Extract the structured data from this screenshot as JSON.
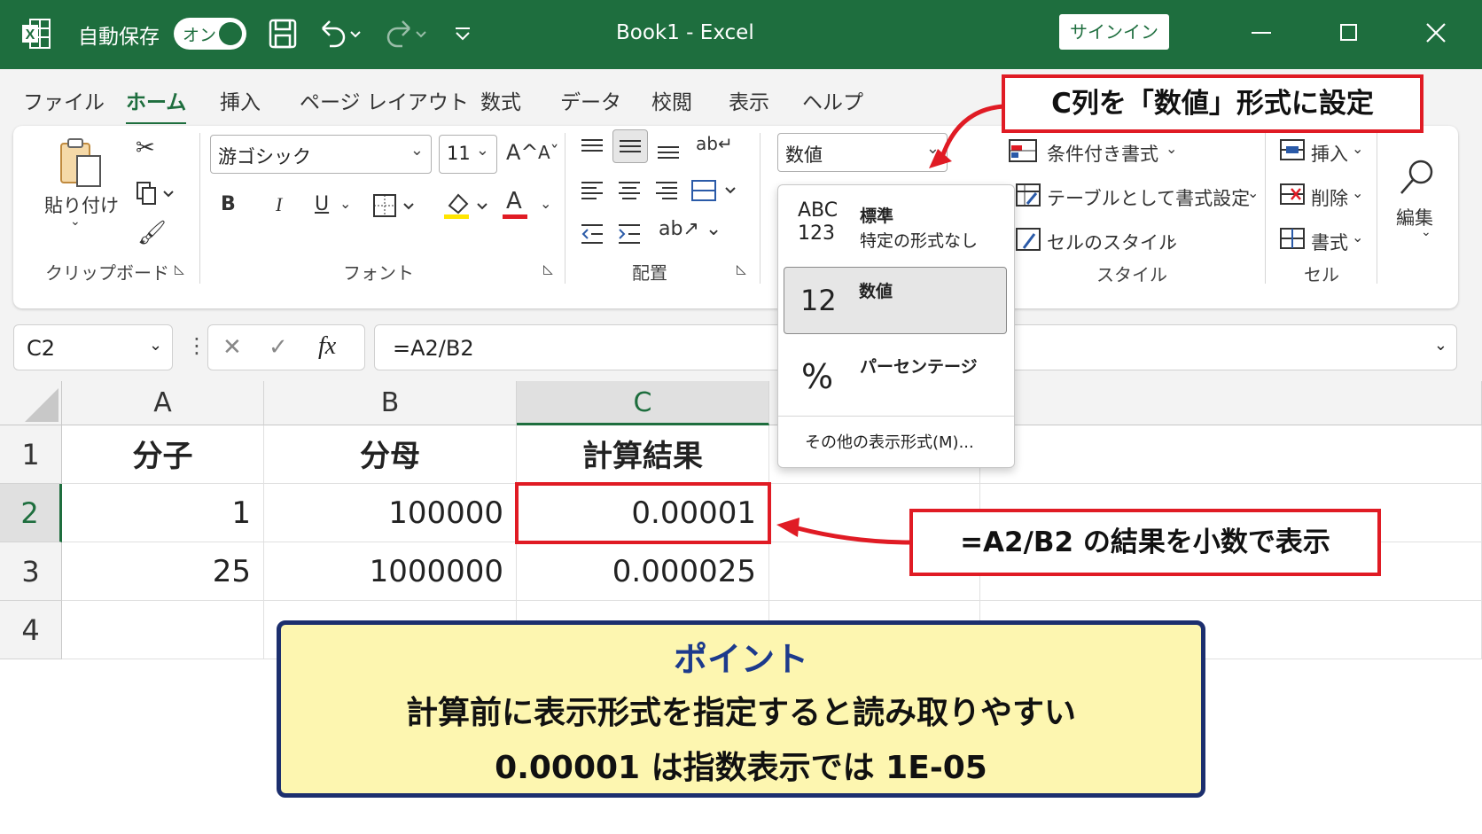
{
  "titlebar": {
    "autosave_label": "自動保存",
    "autosave_state": "オン",
    "document_title": "Book1  -  Excel",
    "signin_label": "サインイン"
  },
  "tabs": [
    "ファイル",
    "ホーム",
    "挿入",
    "ページ レイアウト",
    "数式",
    "データ",
    "校閲",
    "表示",
    "ヘルプ"
  ],
  "active_tab": "ホーム",
  "ribbon": {
    "clipboard": {
      "paste_label": "貼り付け",
      "group_label": "クリップボード"
    },
    "font": {
      "font_name": "游ゴシック",
      "font_size": "11",
      "grow": "A^",
      "shrink": "Aˇ",
      "bold": "B",
      "italic": "I",
      "underline": "U",
      "font_color_glyph": "A",
      "group_label": "フォント"
    },
    "alignment": {
      "group_label": "配置"
    },
    "number": {
      "format_value": "数値"
    },
    "styles": {
      "conditional": "条件付き書式",
      "table": "テーブルとして書式設定",
      "cell_styles": "セルのスタイル",
      "group_label": "スタイル"
    },
    "cells": {
      "insert": "挿入",
      "delete": "削除",
      "format": "書式",
      "group_label": "セル"
    },
    "editing": {
      "label": "編集"
    }
  },
  "number_format_menu": {
    "items": [
      {
        "icon": "ABC\n123",
        "icon_top": "ABC",
        "icon_bottom": "123",
        "title": "標準",
        "subtitle": "特定の形式なし",
        "selected": false
      },
      {
        "icon": "12",
        "title": "数値",
        "subtitle": "",
        "selected": true
      },
      {
        "icon": "%",
        "title": "パーセンテージ",
        "subtitle": "",
        "selected": false
      }
    ],
    "more_label": "その他の表示形式(M)..."
  },
  "formula_bar": {
    "name_box": "C2",
    "fx": "fx",
    "formula": "=A2/B2"
  },
  "sheet": {
    "columns": [
      "A",
      "B",
      "C"
    ],
    "rows": [
      {
        "num": "1",
        "cells": [
          "分子",
          "分母",
          "計算結果"
        ]
      },
      {
        "num": "2",
        "cells": [
          "1",
          "100000",
          "0.00001"
        ]
      },
      {
        "num": "3",
        "cells": [
          "25",
          "1000000",
          "0.000025"
        ]
      },
      {
        "num": "4",
        "cells": [
          "",
          "",
          ""
        ]
      }
    ],
    "selected_cell": "C2"
  },
  "annotations": {
    "top_callout": "C列を「数値」形式に設定",
    "right_callout": "=A2/B2 の結果を小数で表示",
    "point_title": "ポイント",
    "point_line1": "計算前に表示形式を指定すると読み取りやすい",
    "point_line2": "0.00001 は指数表示では 1E-05"
  },
  "colors": {
    "excel_green": "#1e6e3e",
    "callout_red": "#e01b24",
    "point_bg": "#fdf6b0",
    "point_border": "#1c2f6e",
    "point_title": "#1c3a8c"
  }
}
